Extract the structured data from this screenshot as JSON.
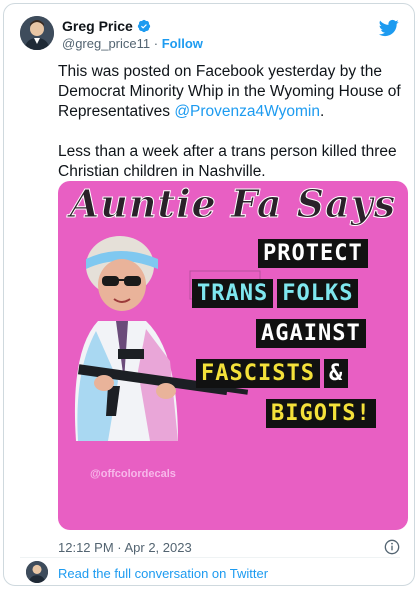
{
  "author": {
    "display_name": "Greg Price",
    "handle": "@greg_price11",
    "separator": "·",
    "follow_label": "Follow"
  },
  "tweet": {
    "paragraph1_text": "This was posted on Facebook yesterday by the Democrat Minority Whip in the Wyoming House of Representatives ",
    "paragraph1_mention": "@Provenza4Wyomin",
    "paragraph1_end": ".",
    "paragraph2_text": "Less than a week after a trans person killed three Christian children in Nashville."
  },
  "media": {
    "title": "Auntie Fa Says",
    "lines": [
      [
        "PROTECT"
      ],
      [
        "TRANS",
        "FOLKS"
      ],
      [
        "AGAINST"
      ],
      [
        "FASCISTS",
        "&"
      ],
      [
        "BIGOTS!"
      ]
    ],
    "watermark": "@offcolordecals"
  },
  "footer": {
    "timestamp": "12:12 PM · Apr 2, 2023",
    "read_more": "Read the full conversation on Twitter"
  },
  "colors": {
    "accent": "#1d9bf0",
    "media_background": "#e85fc3"
  },
  "icons": [
    "verified-badge-icon",
    "twitter-logo-icon",
    "info-icon"
  ]
}
